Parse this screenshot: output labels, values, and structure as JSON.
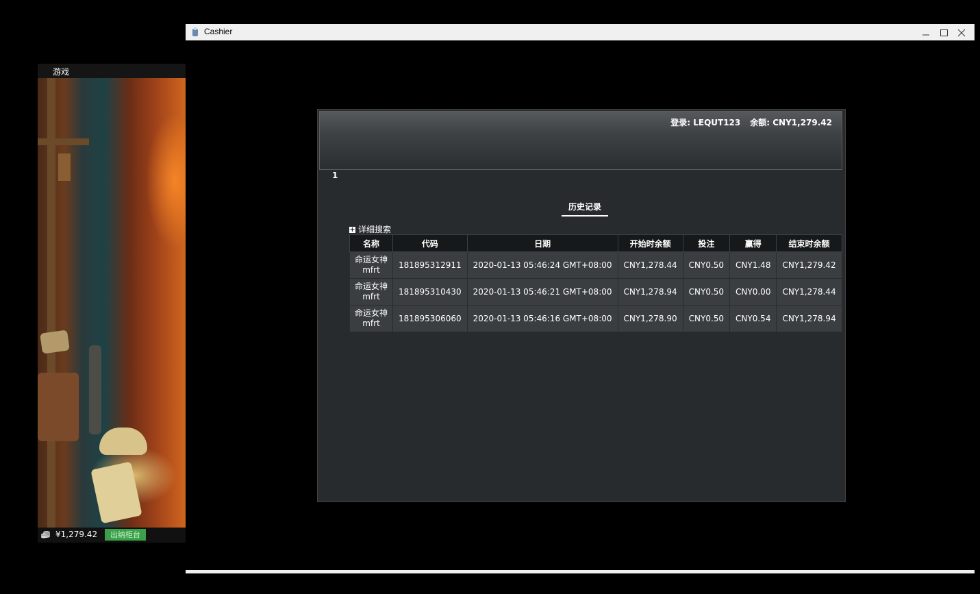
{
  "game_window": {
    "menu_label": "游戏",
    "balance": "¥1,279.42",
    "cashier_button": "出纳柜台",
    "coin_icon": "coins-icon"
  },
  "cashier_window": {
    "title": "Cashier",
    "header": {
      "login": "登录: LEQUT123",
      "balance": "余额: CNY1,279.42"
    },
    "page_number": "1",
    "tab_label": "历史记录",
    "advanced_search": "详细搜索",
    "table": {
      "columns": [
        "名称",
        "代码",
        "日期",
        "开始时余额",
        "投注",
        "赢得",
        "结束时余额"
      ],
      "rows": [
        {
          "name": "命运女神 mfrt",
          "code": "181895312911",
          "date": "2020-01-13 05:46:24 GMT+08:00",
          "start": "CNY1,278.44",
          "bet": "CNY0.50",
          "win": "CNY1.48",
          "end": "CNY1,279.42"
        },
        {
          "name": "命运女神 mfrt",
          "code": "181895310430",
          "date": "2020-01-13 05:46:21 GMT+08:00",
          "start": "CNY1,278.94",
          "bet": "CNY0.50",
          "win": "CNY0.00",
          "end": "CNY1,278.44"
        },
        {
          "name": "命运女神 mfrt",
          "code": "181895306060",
          "date": "2020-01-13 05:46:16 GMT+08:00",
          "start": "CNY1,278.90",
          "bet": "CNY0.50",
          "win": "CNY0.54",
          "end": "CNY1,278.94"
        }
      ]
    }
  }
}
